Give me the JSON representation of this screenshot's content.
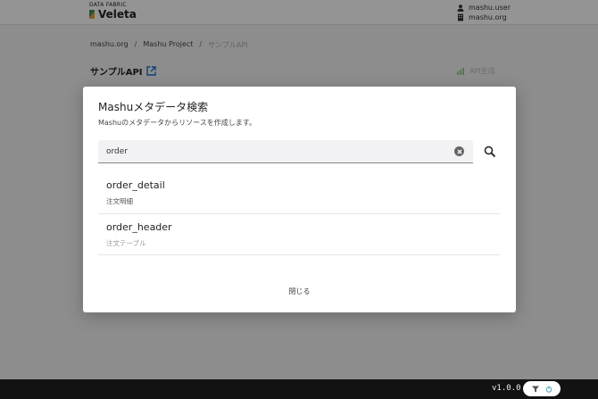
{
  "header": {
    "logo_small": "DATA FABRIC",
    "logo_main": "Veleta",
    "user_name": "mashu.user",
    "org_name": "mashu.org"
  },
  "breadcrumb": [
    "mashu.org",
    "/",
    "Mashu Project",
    "/",
    "サンプルAPI"
  ],
  "page": {
    "title": "サンプルAPI",
    "create_button": "API生成"
  },
  "modal": {
    "title": "Mashuメタデータ検索",
    "description": "Mashuのメタデータからリソースを作成します。",
    "search_value": "order",
    "results": [
      {
        "name": "order_detail",
        "subtitle": "注文明細"
      },
      {
        "name": "order_header",
        "subtitle": "注文テーブル"
      }
    ],
    "close_label": "閉じる"
  },
  "footer": {
    "version": "v1.0.0"
  },
  "colors": {
    "overlay": "#000000",
    "footer_bg": "#121212",
    "logo_green": "#3e8f5b",
    "logo_gold": "#d9a43a"
  }
}
